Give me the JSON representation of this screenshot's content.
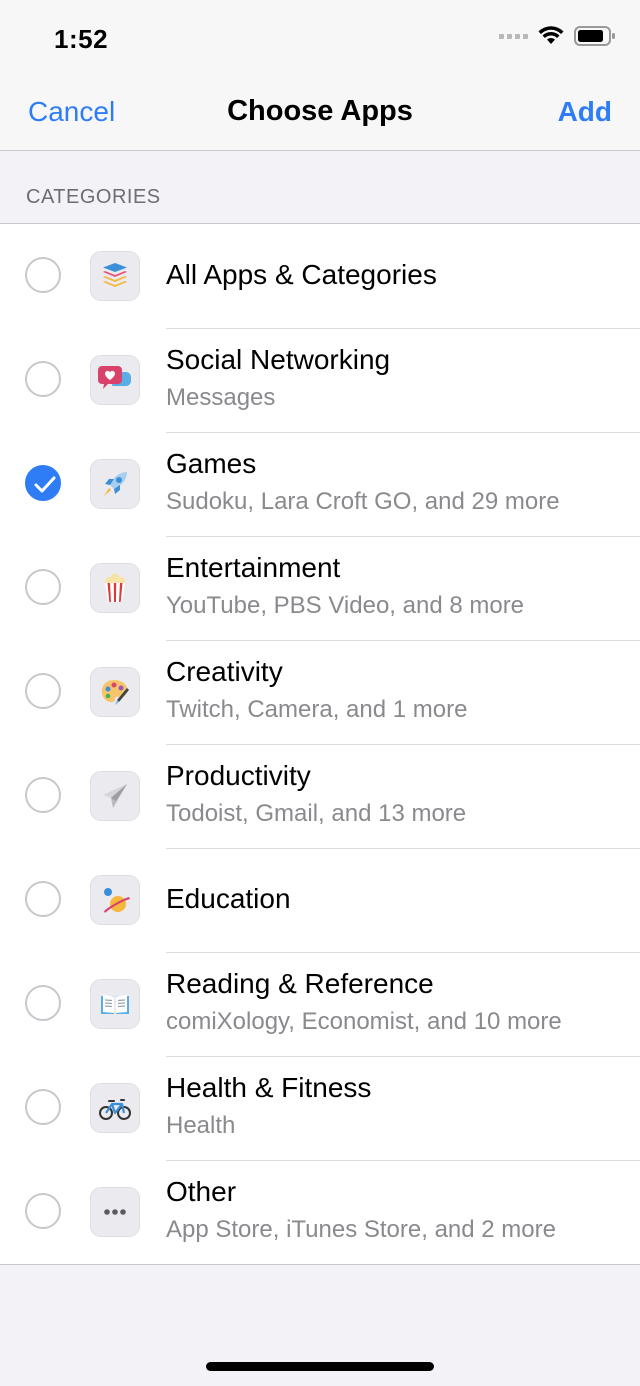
{
  "status_bar": {
    "time": "1:52",
    "icons": [
      "cellular-signal-icon",
      "wifi-icon",
      "battery-icon"
    ]
  },
  "nav": {
    "cancel_label": "Cancel",
    "title": "Choose Apps",
    "add_label": "Add"
  },
  "colors": {
    "accent": "#2f7df6",
    "background": "#f2f2f7",
    "secondary_text": "#8a8a8e"
  },
  "section": {
    "header": "CATEGORIES"
  },
  "categories": [
    {
      "name": "All Apps & Categories",
      "detail": "",
      "icon": "stack-icon",
      "selected": false
    },
    {
      "name": "Social Networking",
      "detail": "Messages",
      "icon": "chat-heart-icon",
      "selected": false
    },
    {
      "name": "Games",
      "detail": "Sudoku, Lara Croft GO, and 29 more",
      "icon": "rocket-icon",
      "selected": true
    },
    {
      "name": "Entertainment",
      "detail": "YouTube, PBS Video, and 8 more",
      "icon": "popcorn-icon",
      "selected": false
    },
    {
      "name": "Creativity",
      "detail": "Twitch, Camera, and 1 more",
      "icon": "palette-icon",
      "selected": false
    },
    {
      "name": "Productivity",
      "detail": "Todoist, Gmail, and 13 more",
      "icon": "paper-plane-icon",
      "selected": false
    },
    {
      "name": "Education",
      "detail": "",
      "icon": "planet-icon",
      "selected": false
    },
    {
      "name": "Reading & Reference",
      "detail": "comiXology, Economist, and 10 more",
      "icon": "open-book-icon",
      "selected": false
    },
    {
      "name": "Health & Fitness",
      "detail": "Health",
      "icon": "bicycle-icon",
      "selected": false
    },
    {
      "name": "Other",
      "detail": "App Store, iTunes Store, and 2 more",
      "icon": "ellipsis-icon",
      "selected": false
    }
  ]
}
